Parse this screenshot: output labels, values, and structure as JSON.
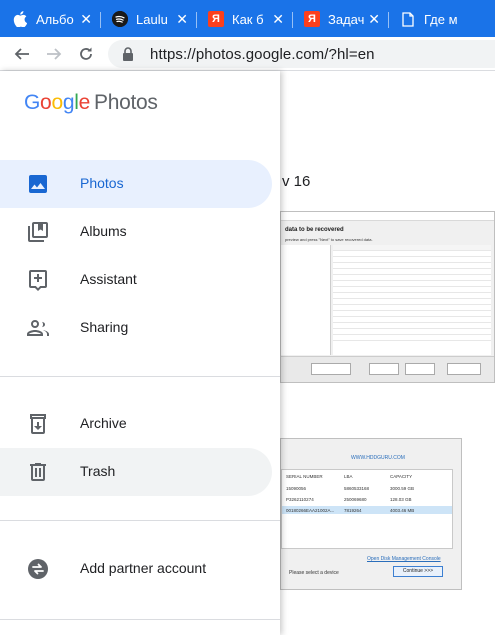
{
  "browser": {
    "tabs": [
      {
        "label": "Альбо",
        "favicon": "apple-icon"
      },
      {
        "label": "Laulu",
        "favicon": "spotify-icon"
      },
      {
        "label": "Как б",
        "favicon": "yandex-icon"
      },
      {
        "label": "Задач",
        "favicon": "yandex-icon"
      },
      {
        "label": "Где м",
        "favicon": "document-icon"
      }
    ],
    "tab_close": "✕",
    "favicon_letter_yandex": "Я",
    "url": "https://photos.google.com/?hl=en",
    "accent": "#1a73e8"
  },
  "drawer": {
    "logo_brand": "Google",
    "logo_product": "Photos",
    "nav": [
      {
        "label": "Photos",
        "icon": "photo-icon"
      },
      {
        "label": "Albums",
        "icon": "albums-icon"
      },
      {
        "label": "Assistant",
        "icon": "assistant-icon"
      },
      {
        "label": "Sharing",
        "icon": "sharing-icon"
      },
      {
        "label": "Archive",
        "icon": "archive-icon"
      },
      {
        "label": "Trash",
        "icon": "trash-icon"
      },
      {
        "label": "Add partner account",
        "icon": "partner-icon"
      }
    ]
  },
  "background": {
    "heading_fragment": "v 16",
    "screenshot1": {
      "title": "data to be recovered",
      "subtitle": "preview and press \"Next\" to save recovered data."
    },
    "screenshot2": {
      "site": "WWW.HDDGURU.COM",
      "columns": [
        "SERIAL NUMBER",
        "LBA",
        "CAPACITY"
      ],
      "rows": [
        [
          "15090056",
          "5860533168",
          "3000.59 GB"
        ],
        [
          "P3262110274",
          "250069680",
          "128.03 GB"
        ],
        [
          "00180266EAA21002A...",
          "7819264",
          "4003.46 MB"
        ]
      ],
      "link": "Open Disk Management Console",
      "prompt": "Please select a device",
      "button": "Continue >>>"
    }
  }
}
